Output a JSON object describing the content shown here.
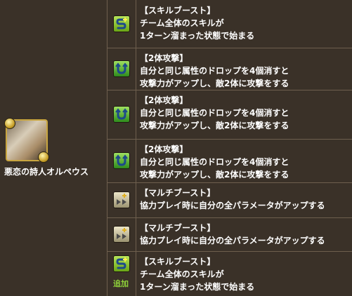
{
  "monster": {
    "name": "悪恋の詩人オルペウス"
  },
  "awakenings": [
    {
      "icon": "skill-boost-icon",
      "title": "【スキルブースト】",
      "lines": [
        "チーム全体のスキルが",
        "1ターン溜まった状態で始まる"
      ],
      "added": ""
    },
    {
      "icon": "two-pronged-attack-icon",
      "title": "【2体攻撃】",
      "lines": [
        "自分と同じ属性のドロップを4個消すと",
        "攻撃力がアップし、敵2体に攻撃をする"
      ],
      "added": ""
    },
    {
      "icon": "two-pronged-attack-icon",
      "title": "【2体攻撃】",
      "lines": [
        "自分と同じ属性のドロップを4個消すと",
        "攻撃力がアップし、敵2体に攻撃をする"
      ],
      "added": ""
    },
    {
      "icon": "two-pronged-attack-icon",
      "title": "【2体攻撃】",
      "lines": [
        "自分と同じ属性のドロップを4個消すと",
        "攻撃力がアップし、敵2体に攻撃をする"
      ],
      "added": ""
    },
    {
      "icon": "multi-boost-icon",
      "title": "【マルチブースト】",
      "lines": [
        "協力プレイ時に自分の全パラメータがアップする"
      ],
      "added": ""
    },
    {
      "icon": "multi-boost-icon",
      "title": "【マルチブースト】",
      "lines": [
        "協力プレイ時に自分の全パラメータがアップする"
      ],
      "added": ""
    },
    {
      "icon": "skill-boost-icon",
      "title": "【スキルブースト】",
      "lines": [
        "チーム全体のスキルが",
        "1ターン溜まった状態で始まる"
      ],
      "added": "追加"
    }
  ]
}
